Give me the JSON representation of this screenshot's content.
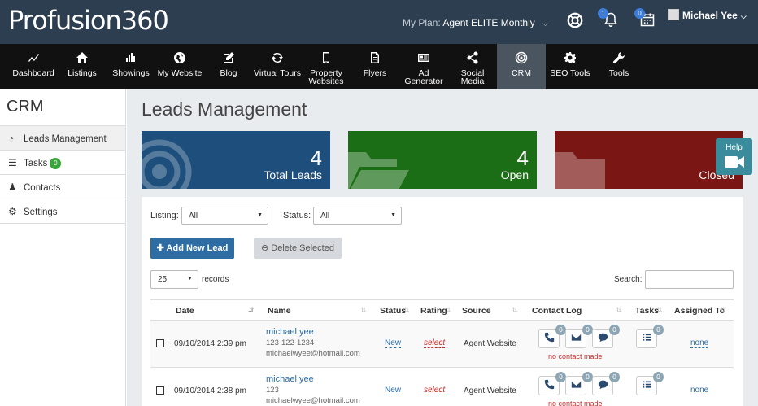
{
  "topbar": {
    "logo": "Profusion360",
    "plan_label": "My Plan:",
    "plan_value": "Agent ELITE Monthly",
    "notifications_count": "1",
    "calendar_count": "0",
    "user_name": "Michael Yee"
  },
  "nav": [
    {
      "label": "Dashboard",
      "icon": "chart-icon"
    },
    {
      "label": "Listings",
      "icon": "home-icon"
    },
    {
      "label": "Showings",
      "icon": "bar-chart-icon"
    },
    {
      "label": "My Website",
      "icon": "globe-icon"
    },
    {
      "label": "Blog",
      "icon": "edit-icon"
    },
    {
      "label": "Virtual Tours",
      "icon": "refresh-icon"
    },
    {
      "label": "Property Websites",
      "icon": "mobile-icon"
    },
    {
      "label": "Flyers",
      "icon": "file-icon"
    },
    {
      "label": "Ad Generator",
      "icon": "newspaper-icon"
    },
    {
      "label": "Social Media",
      "icon": "share-icon"
    },
    {
      "label": "CRM",
      "icon": "target-icon"
    },
    {
      "label": "SEO Tools",
      "icon": "gear-icon"
    },
    {
      "label": "Tools",
      "icon": "wrench-icon"
    }
  ],
  "sidebar": {
    "title": "CRM",
    "items": [
      {
        "label": "Leads Management",
        "icon": "dashboard-icon"
      },
      {
        "label": "Tasks",
        "icon": "list-icon",
        "badge": "0"
      },
      {
        "label": "Contacts",
        "icon": "users-icon"
      },
      {
        "label": "Settings",
        "icon": "gear-icon"
      }
    ]
  },
  "main": {
    "title": "Leads Management",
    "stats": [
      {
        "value": "4",
        "label": "Total Leads",
        "color": "#1e4f7c"
      },
      {
        "value": "4",
        "label": "Open",
        "color": "#1c6e16"
      },
      {
        "value": "",
        "label": "Closed",
        "color": "#7a1614"
      }
    ],
    "help_label": "Help",
    "filters": {
      "listing_label": "Listing:",
      "listing_value": "All",
      "status_label": "Status:",
      "status_value": "All"
    },
    "add_button": "Add New Lead",
    "delete_button": "Delete Selected",
    "records_value": "25",
    "records_label": "records",
    "search_label": "Search:",
    "columns": [
      "Date",
      "Name",
      "Status",
      "Rating",
      "Source",
      "Contact Log",
      "Tasks",
      "Assigned To"
    ],
    "rows": [
      {
        "date": "09/10/2014 2:39 pm",
        "name": "michael yee",
        "phone": "123-122-1234",
        "email": "michaelwyee@hotmail.com",
        "status": "New",
        "rating": "select",
        "source": "Agent Website",
        "call_count": "0",
        "email_count": "0",
        "chat_count": "0",
        "contact_note": "no contact made",
        "task_count": "0",
        "assigned": "none"
      },
      {
        "date": "09/10/2014 2:38 pm",
        "name": "michael yee",
        "phone": "123",
        "email": "michaelwyee@hotmail.com",
        "status": "New",
        "rating": "select",
        "source": "Agent Website",
        "call_count": "0",
        "email_count": "0",
        "chat_count": "0",
        "contact_note": "no contact made",
        "task_count": "0",
        "assigned": "none"
      }
    ]
  }
}
